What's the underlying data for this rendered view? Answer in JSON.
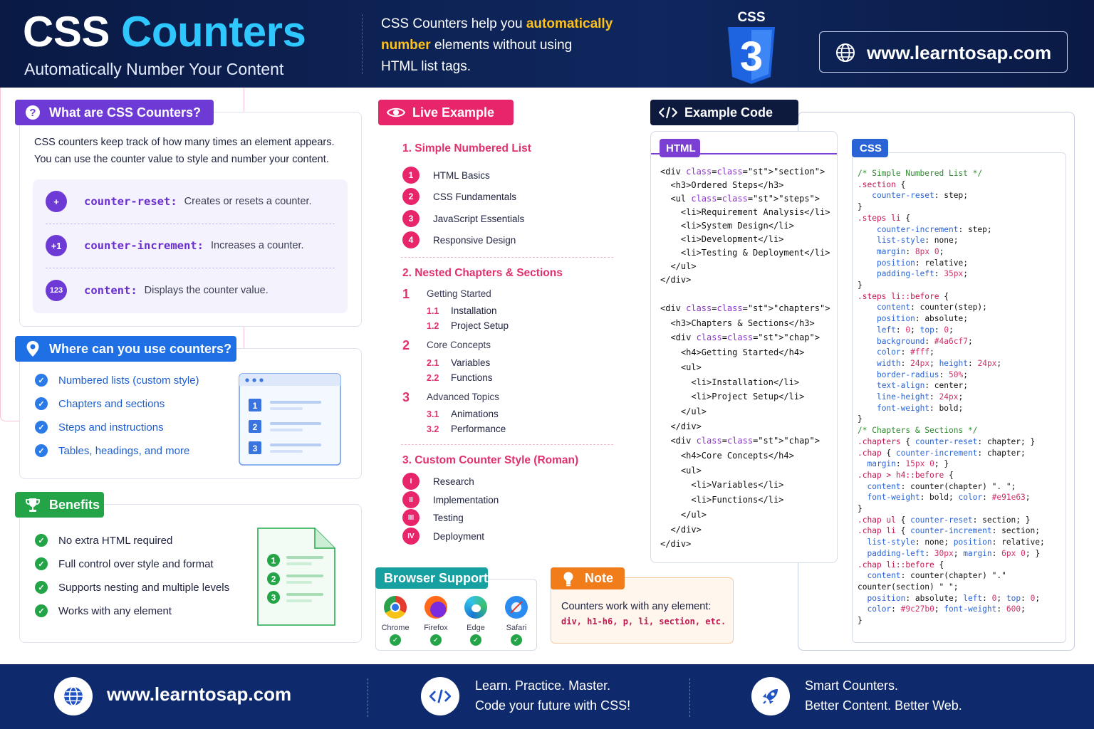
{
  "header": {
    "title_part1": "CSS",
    "title_part2": "Counters",
    "subtitle": "Automatically Number Your Content",
    "desc_pre": "CSS Counters help you ",
    "desc_hl1": "automatically",
    "desc_hl2": "number",
    "desc_post": " elements without using",
    "desc_line3": "HTML list tags.",
    "logo_text": "CSS",
    "logo_number": "3",
    "url": "www.learntosap.com"
  },
  "what": {
    "title": "What are CSS Counters?",
    "desc_line1": "CSS counters keep track of how many times an element appears.",
    "desc_line2": "You can use the counter value to style and number your content.",
    "props": [
      {
        "badge": "+",
        "key": "counter-reset:",
        "val": "Creates or resets a counter."
      },
      {
        "badge": "+1",
        "key": "counter-increment:",
        "val": "Increases a counter."
      },
      {
        "badge": "123",
        "key": "content:",
        "val": "Displays the counter value."
      }
    ]
  },
  "where": {
    "title": "Where can you use counters?",
    "items": [
      "Numbered lists (custom style)",
      "Chapters and sections",
      "Steps and instructions",
      "Tables, headings, and more"
    ],
    "illus_numbers": [
      "1",
      "2",
      "3"
    ]
  },
  "benefits": {
    "title": "Benefits",
    "items": [
      "No extra HTML required",
      "Full control over style and format",
      "Supports nesting and multiple levels",
      "Works with any element"
    ],
    "illus_numbers": [
      "1",
      "2",
      "3"
    ]
  },
  "live": {
    "title": "Live Example",
    "s1_title": "1. Simple Numbered List",
    "s1_items": [
      {
        "n": "1",
        "t": "HTML Basics"
      },
      {
        "n": "2",
        "t": "CSS Fundamentals"
      },
      {
        "n": "3",
        "t": "JavaScript Essentials"
      },
      {
        "n": "4",
        "t": "Responsive Design"
      }
    ],
    "s2_title": "2. Nested Chapters & Sections",
    "chapters": [
      {
        "n": "1",
        "t": "Getting Started",
        "subs": [
          {
            "n": "1.1",
            "t": "Installation"
          },
          {
            "n": "1.2",
            "t": "Project Setup"
          }
        ]
      },
      {
        "n": "2",
        "t": "Core Concepts",
        "subs": [
          {
            "n": "2.1",
            "t": "Variables"
          },
          {
            "n": "2.2",
            "t": "Functions"
          }
        ]
      },
      {
        "n": "3",
        "t": "Advanced Topics",
        "subs": [
          {
            "n": "3.1",
            "t": "Animations"
          },
          {
            "n": "3.2",
            "t": "Performance"
          }
        ]
      }
    ],
    "s3_title": "3. Custom Counter Style (Roman)",
    "s3_items": [
      {
        "n": "I",
        "t": "Research"
      },
      {
        "n": "II",
        "t": "Implementation"
      },
      {
        "n": "III",
        "t": "Testing"
      },
      {
        "n": "IV",
        "t": "Deployment"
      }
    ]
  },
  "code": {
    "title": "Example Code",
    "html_tab": "HTML",
    "css_tab": "CSS",
    "html_lines": [
      "<div class=\"section\">",
      "  <h3>Ordered Steps</h3>",
      "  <ul class=\"steps\">",
      "    <li>Requirement Analysis</li>",
      "    <li>System Design</li>",
      "    <li>Development</li>",
      "    <li>Testing & Deployment</li>",
      "  </ul>",
      "</div>",
      "<div class=\"chapters\">",
      "  <h3>Chapters & Sections</h3>",
      "  <div class=\"chap\">",
      "    <h4>Getting Started</h4>",
      "    <ul>",
      "      <li>Installation</li>",
      "      <li>Project Setup</li>",
      "    </ul>",
      "  </div>",
      "  <div class=\"chap\">",
      "    <h4>Core Concepts</h4>",
      "    <ul>",
      "      <li>Variables</li>",
      "      <li>Functions</li>",
      "    </ul>",
      "  </div>",
      "</div>"
    ],
    "css_lines": [
      "/* Simple Numbered List */",
      ".section {",
      "   counter-reset: step;",
      "}",
      ".steps li {",
      "    counter-increment: step;",
      "    list-style: none;",
      "    margin: 8px 0;",
      "    position: relative;",
      "    padding-left: 35px;",
      "}",
      ".steps li::before {",
      "    content: counter(step);",
      "    position: absolute;",
      "    left: 0; top: 0;",
      "    background: #4a6cf7;",
      "    color: #fff;",
      "    width: 24px; height: 24px;",
      "    border-radius: 50%;",
      "    text-align: center;",
      "    line-height: 24px;",
      "    font-weight: bold;",
      "}",
      "/* Chapters & Sections */",
      ".chapters { counter-reset: chapter; }",
      ".chap { counter-increment: chapter;",
      "  margin: 15px 0; }",
      ".chap > h4::before {",
      "  content: counter(chapter) \". \";",
      "  font-weight: bold; color: #e91e63;",
      "}",
      ".chap ul { counter-reset: section; }",
      ".chap li { counter-increment: section;",
      "  list-style: none; position: relative;",
      "  padding-left: 30px; margin: 6px 0; }",
      ".chap li::before {",
      "  content: counter(chapter) \".\"",
      "counter(section) \" \";",
      "  position: absolute; left: 0; top: 0;",
      "  color: #9c27b0; font-weight: 600;",
      "}"
    ]
  },
  "browser": {
    "title": "Browser Support",
    "items": [
      "Chrome",
      "Firefox",
      "Edge",
      "Safari"
    ]
  },
  "note": {
    "title": "Note",
    "text": "Counters work with any element:",
    "code": "div, h1-h6, p, li, section, etc."
  },
  "footer": {
    "url": "www.learntosap.com",
    "mid_line1": "Learn. Practice. Master.",
    "mid_line2": "Code your future with CSS!",
    "right_line1": "Smart Counters.",
    "right_line2": "Better Content. Better Web."
  },
  "colors": {
    "header_bg": "#0a1a45",
    "accent_cyan": "#2fc7ff",
    "accent_yellow": "#ffc21a",
    "purple": "#6e3ad6",
    "blue": "#1f6fe5",
    "green": "#22a447",
    "pink": "#e8256a",
    "navy": "#0e1a3d",
    "teal": "#16a0a0",
    "orange": "#f07d1a",
    "footer_bg": "#0f2a6c"
  }
}
